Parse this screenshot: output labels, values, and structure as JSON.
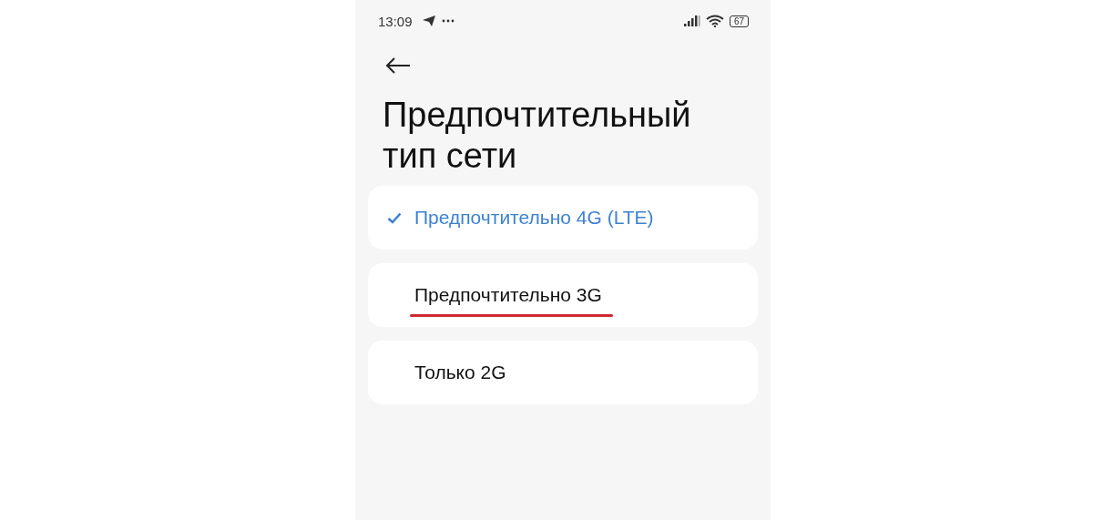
{
  "status_bar": {
    "time": "13:09",
    "battery": "67"
  },
  "title": "Предпочтительный тип сети",
  "options": [
    {
      "label": "Предпочтительно 4G (LTE)",
      "selected": true,
      "underlined": false
    },
    {
      "label": "Предпочтительно 3G",
      "selected": false,
      "underlined": true
    },
    {
      "label": "Только 2G",
      "selected": false,
      "underlined": false
    }
  ]
}
